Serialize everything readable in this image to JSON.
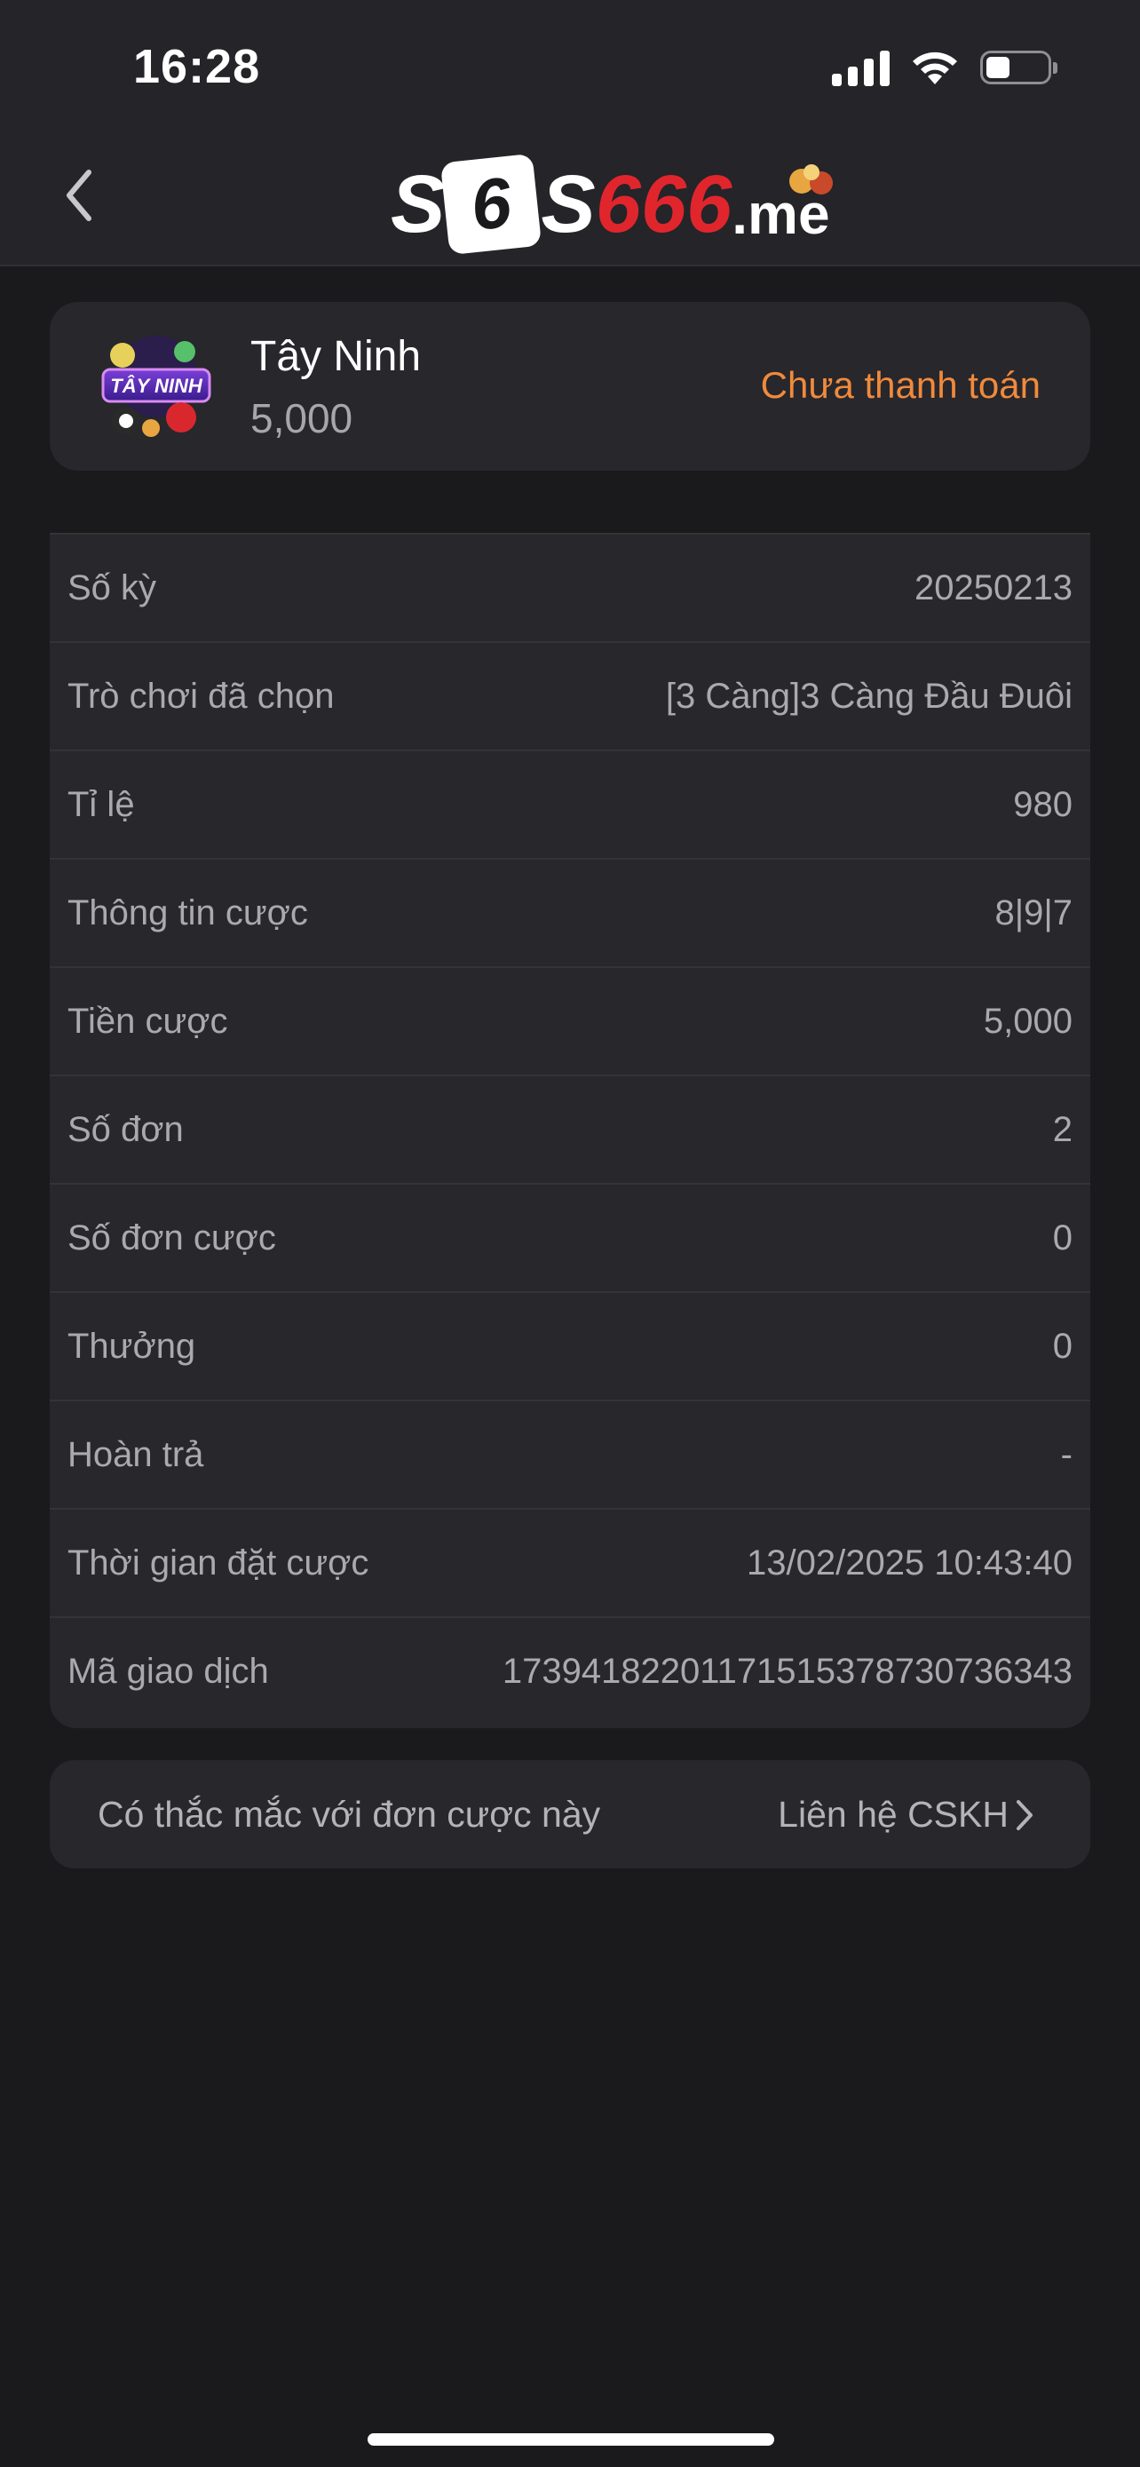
{
  "status_bar": {
    "time": "16:28"
  },
  "header": {
    "back_icon": "chevron-left-icon",
    "logo": {
      "dice_letter": "6",
      "prefix": "S",
      "mid": "S",
      "number": "666",
      "suffix": ".me"
    }
  },
  "summary": {
    "game_name": "Tây Ninh",
    "amount": "5,000",
    "status": "Chưa thanh toán",
    "status_color": "#f08a3c",
    "icon": "tay-ninh-lottery-icon",
    "icon_text": "TÂY NINH"
  },
  "details": [
    {
      "label": "Số kỳ",
      "value": "20250213"
    },
    {
      "label": "Trò chơi đã chọn",
      "value": "[3 Càng]3 Càng Đầu Đuôi"
    },
    {
      "label": "Tỉ lệ",
      "value": "980"
    },
    {
      "label": "Thông tin cược",
      "value": "8|9|7"
    },
    {
      "label": "Tiền cược",
      "value": "5,000"
    },
    {
      "label": "Số đơn",
      "value": "2"
    },
    {
      "label": "Số đơn cược",
      "value": "0"
    },
    {
      "label": "Thưởng",
      "value": "0"
    },
    {
      "label": "Hoàn trả",
      "value": "-"
    },
    {
      "label": "Thời gian đặt cược",
      "value": "13/02/2025 10:43:40"
    },
    {
      "label": "Mã giao dịch",
      "value": "17394182201171515378730736343"
    }
  ],
  "support": {
    "question": "Có thắc mắc với đơn cược này",
    "link": "Liên hệ CSKH",
    "chevron_icon": "chevron-right-icon"
  },
  "colors": {
    "background": "#1a1a1c",
    "card": "#27272c",
    "accent_orange": "#f08a3c",
    "logo_red": "#e0262c"
  }
}
